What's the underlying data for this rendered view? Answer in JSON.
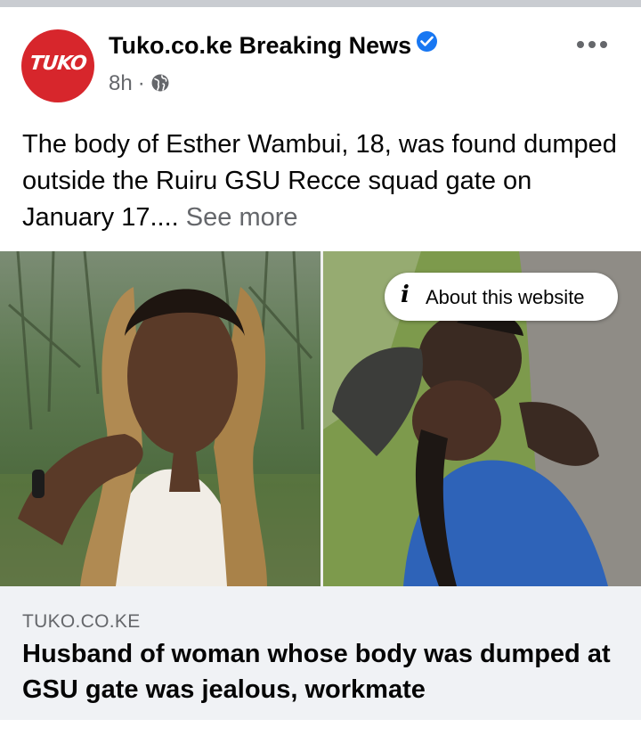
{
  "post": {
    "page_name": "Tuko.co.ke Breaking News",
    "avatar_text": "TUKO",
    "time": "8h",
    "separator": "·",
    "audience_icon": "globe-icon",
    "more_icon": "more-horizontal-icon",
    "verified_icon": "verified-badge-icon",
    "caption": "The body of Esther Wambui, 18, was found dumped outside the Ruiru GSU Recce squad gate on January 17.... ",
    "see_more": "See more"
  },
  "media": {
    "about_label": "About this website",
    "info_icon": "info-icon"
  },
  "link": {
    "domain": "TUKO.CO.KE",
    "title": "Husband of woman whose body was dumped at GSU gate was jealous, workmate"
  },
  "colors": {
    "brand_red": "#d7262c",
    "verified_blue": "#1877f2",
    "secondary_text": "#65676b",
    "link_background": "#f0f2f5"
  }
}
